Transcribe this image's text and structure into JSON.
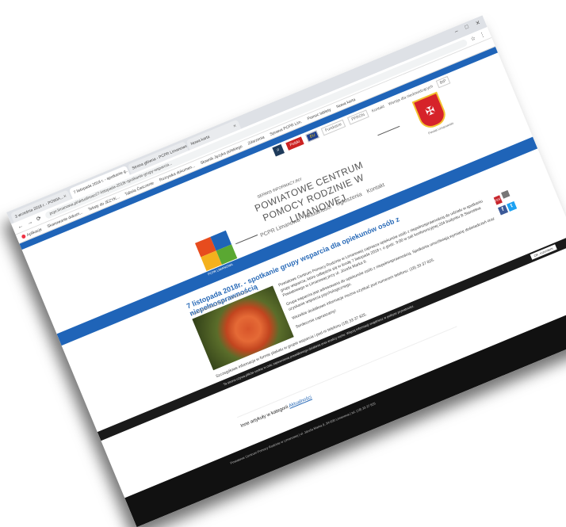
{
  "browser": {
    "tabs": [
      {
        "label": "3 września 2018 r. - POWIA..."
      },
      {
        "label": "7 listopada 2018 r. - spotkanie g..."
      },
      {
        "label": "Strona główna - PCPR Limanowa"
      },
      {
        "label": "Nowa karta"
      }
    ],
    "url": "pcpr.limanowa.pl/aktualnosci/7-listopada-2018r-spotkanie-grupy-wsparcia...",
    "bookmarks": [
      "Aplikacje",
      "Skanowanie dokum...",
      "Teksty do JEZYK...",
      "Tabela Ćwiczenie",
      "Rozrywka dokumen...",
      "Słownik Języka polskiego",
      "Zdarzenia",
      "Sprawa PCPR Lim.",
      "Pomoc tablety",
      "Nowa karta"
    ]
  },
  "utility": {
    "search_icon": "search-icon",
    "badges": [
      "Polski",
      "EU",
      "Fundusze",
      "PFRON",
      "Kontakt",
      "Wersja dla niedowidzących",
      "BIP"
    ],
    "badge_colors": {
      "red": "#cc2222",
      "eu": "#1d3f91"
    }
  },
  "header": {
    "coat_label": "Powiat Limanowski",
    "org_small": "SERWIS INFORMACYJNY",
    "org_title": "POWIATOWE CENTRUM POMOCY RODZINIE W LIMANOWEJ",
    "logo_text": "PCPR LIMANOWA",
    "nav": [
      "PCPR Limanowa",
      "Aktualności",
      "Ogłoszenia",
      "Kontakt"
    ]
  },
  "article": {
    "title": "7 listopada 2018r. - spotkanie grupy wsparcia dla opiekunów osób z niepełnosprawnością",
    "date": "7 października 2018 r. • Aktualności",
    "paragraphs": [
      "Powiatowe Centrum Pomocy Rodzinie w Limanowej zaprasza opiekunów osób z niepełnosprawnością do udziału w spotkaniu grupy wsparcia, które odbędzie się w środę 7 listopada 2018 r. o godz. 9:00 w sali konferencyjnej 204 budynku B Starostwa Powiatowego w Limanowej przy ul. Józefa Marka 9.",
      "Grupa wsparcia jest adresowana do opiekunów osób z niepełnosprawnością. Spotkania umożliwiają wymianę doświadczeń oraz uzyskanie wsparcia psychologicznego.",
      "Wszelkie dodatkowe informacje można uzyskać pod numerem telefonu: (18) 33 37 825.",
      "Serdecznie zapraszamy!"
    ],
    "after_photo": "Szczegółowe informacje w formie plakatu w grupie wsparcia i pod nr telefonu (18) 33 37 825.",
    "share": [
      "pdf-icon",
      "print-icon",
      "facebook-icon",
      "twitter-icon"
    ]
  },
  "cookie": {
    "text": "Ta strona używa plików cookie w celu zapewnienia prawidłowego działania oraz analizy ruchu. Więcej informacji znajdziesz w polityce prywatności.",
    "button": "OK, rozumiem"
  },
  "more": {
    "prefix": "Inne artykuły w kategorii",
    "link": "Aktualności"
  },
  "footer": {
    "text": "Powiatowe Centrum Pomocy Rodzinie w Limanowej | ul. Józefa Marka 9, 34-600 Limanowa | tel. (18) 33 37 825"
  }
}
